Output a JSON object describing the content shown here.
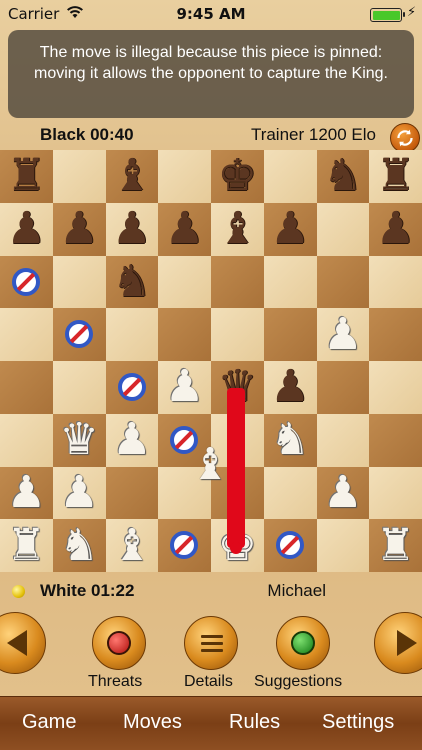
{
  "status_bar": {
    "carrier": "Carrier",
    "time": "9:45 AM",
    "battery_level": 1.0,
    "battery_color": "#49c82a",
    "icons": [
      "wifi-icon",
      "battery-icon",
      "charging-bolt-icon"
    ]
  },
  "message": {
    "text": "The move is illegal because this piece is pinned: moving it allows the opponent to capture the King."
  },
  "top_player": {
    "label": "Black 00:40",
    "opponent": "Trainer 1200 Elo",
    "icon": "rotate-board-icon"
  },
  "bottom_player": {
    "label": "White 01:22",
    "name": "Michael",
    "turn_indicator_color": "#e5c20b"
  },
  "board": {
    "orientation": "white-at-bottom",
    "light_color": "#f2dfb9",
    "dark_color": "#c08a4e",
    "pieces": [
      {
        "square": "a8",
        "color": "black",
        "type": "rook"
      },
      {
        "square": "c8",
        "color": "black",
        "type": "bishop"
      },
      {
        "square": "e8",
        "color": "black",
        "type": "king"
      },
      {
        "square": "g8",
        "color": "black",
        "type": "knight"
      },
      {
        "square": "h8",
        "color": "black",
        "type": "rook"
      },
      {
        "square": "a7",
        "color": "black",
        "type": "pawn"
      },
      {
        "square": "b7",
        "color": "black",
        "type": "pawn"
      },
      {
        "square": "c7",
        "color": "black",
        "type": "pawn"
      },
      {
        "square": "d7",
        "color": "black",
        "type": "pawn"
      },
      {
        "square": "e7",
        "color": "black",
        "type": "bishop"
      },
      {
        "square": "f7",
        "color": "black",
        "type": "pawn"
      },
      {
        "square": "h7",
        "color": "black",
        "type": "pawn"
      },
      {
        "square": "c6",
        "color": "black",
        "type": "knight"
      },
      {
        "square": "g5",
        "color": "white",
        "type": "pawn"
      },
      {
        "square": "d4",
        "color": "white",
        "type": "pawn"
      },
      {
        "square": "e4",
        "color": "black",
        "type": "queen"
      },
      {
        "square": "f4",
        "color": "black",
        "type": "pawn"
      },
      {
        "square": "b3",
        "color": "white",
        "type": "queen"
      },
      {
        "square": "c3",
        "color": "white",
        "type": "pawn"
      },
      {
        "square": "f3",
        "color": "white",
        "type": "knight"
      },
      {
        "square": "a2",
        "color": "white",
        "type": "pawn"
      },
      {
        "square": "b2",
        "color": "white",
        "type": "pawn"
      },
      {
        "square": "g2",
        "color": "white",
        "type": "pawn"
      },
      {
        "square": "a1",
        "color": "white",
        "type": "rook"
      },
      {
        "square": "b1",
        "color": "white",
        "type": "knight"
      },
      {
        "square": "c1",
        "color": "white",
        "type": "bishop"
      },
      {
        "square": "e1",
        "color": "white",
        "type": "king"
      },
      {
        "square": "h1",
        "color": "white",
        "type": "rook"
      }
    ],
    "dragged_piece": {
      "color": "white",
      "type": "bishop",
      "from": "e2",
      "over": "e2/d2 boundary"
    },
    "illegal_move_markers": [
      "a6",
      "b5",
      "c4",
      "d3",
      "d1",
      "f1"
    ],
    "illegal_marker_icon": "no-entry-icon",
    "threat_line": {
      "from": "e4",
      "to": "e1",
      "color": "#e0081a"
    }
  },
  "toolbar": {
    "prev_icon": "previous-move-icon",
    "next_icon": "next-move-icon",
    "threats_label": "Threats",
    "details_label": "Details",
    "suggestions_label": "Suggestions"
  },
  "menu": {
    "game": "Game",
    "moves": "Moves",
    "rules": "Rules",
    "settings": "Settings"
  }
}
